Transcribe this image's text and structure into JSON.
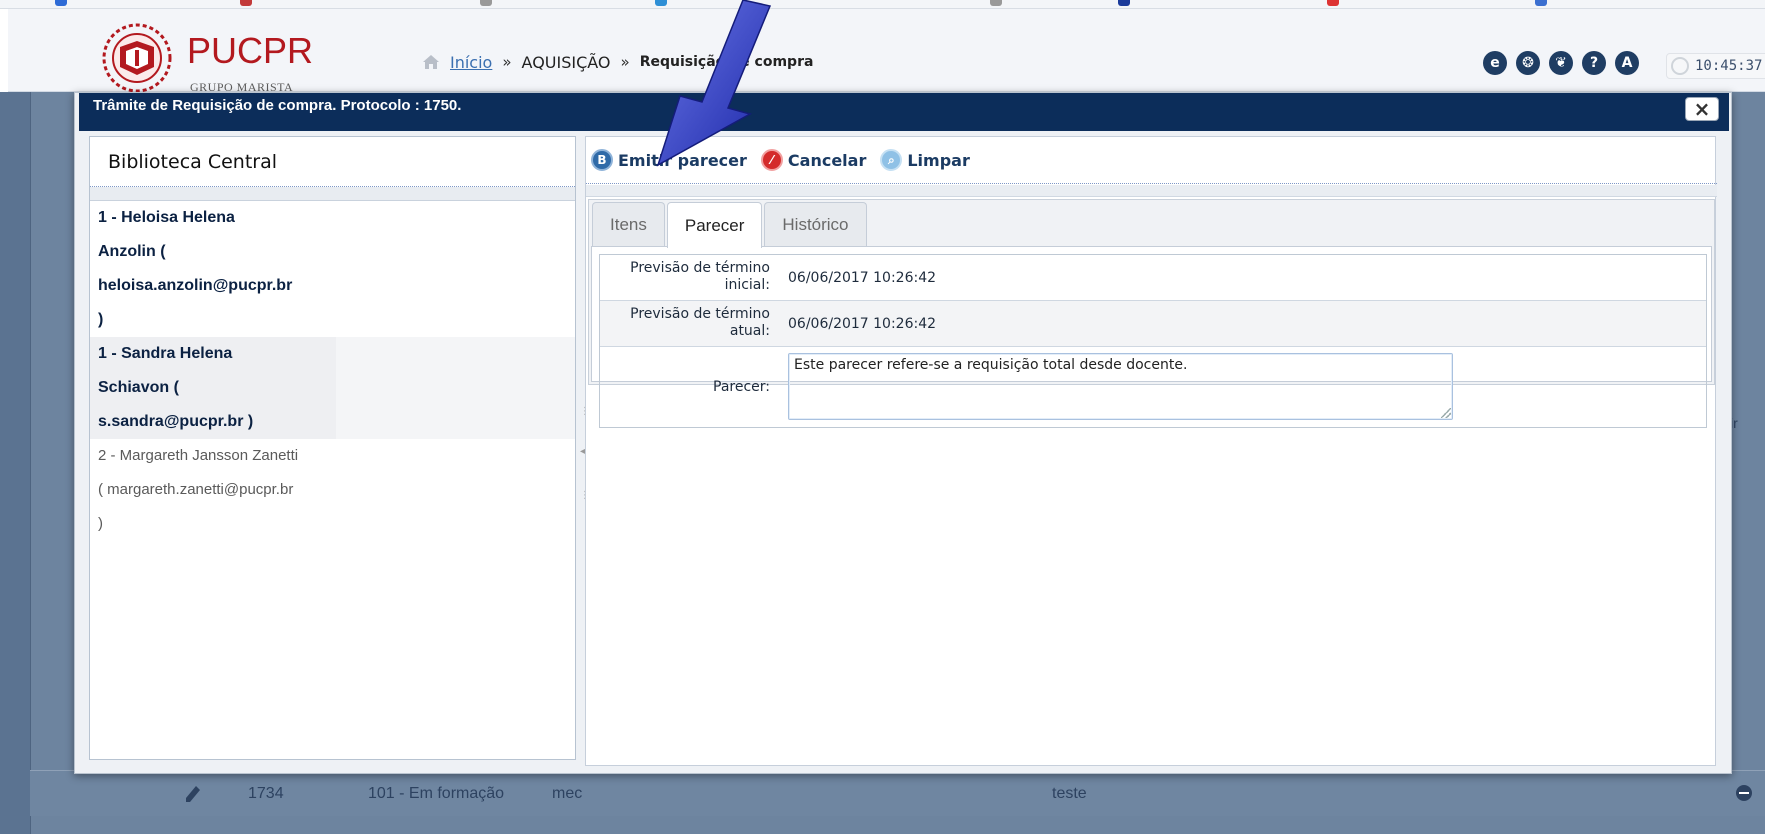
{
  "header": {
    "logo_name": "PUCPR",
    "logo_sub": "GRUPO MARISTA",
    "breadcrumb": {
      "home_label": "Início",
      "separator": "»",
      "section": "AQUISIÇÃO",
      "current": "Requisição de compra"
    },
    "icons": [
      "ie-icon",
      "leaf-icon",
      "paw-icon",
      "help-icon",
      "user-icon"
    ],
    "clock": "10:45:37"
  },
  "modal": {
    "title": "Trâmite de Requisição de compra. Protocolo : 1750.",
    "close_label": "×"
  },
  "left_pane": {
    "title": "Biblioteca Central",
    "people": [
      {
        "lines": [
          "1 - Heloisa Helena",
          "Anzolin (",
          "heloisa.anzolin@pucpr.br",
          ")"
        ]
      },
      {
        "lines": [
          "1 - Sandra Helena",
          "Schiavon (",
          "s.sandra@pucpr.br )"
        ]
      },
      {
        "lines": [
          "2 - Margareth Jansson Zanetti",
          "( margareth.zanetti@pucpr.br",
          ")"
        ]
      }
    ]
  },
  "toolbar": {
    "emit_label": "Emitir parecer",
    "cancel_label": "Cancelar",
    "clear_label": "Limpar"
  },
  "tabs": [
    "Itens",
    "Parecer",
    "Histórico"
  ],
  "active_tab": "Parecer",
  "form": {
    "initial_label": "Previsão de término inicial:",
    "initial_value": "06/06/2017 10:26:42",
    "current_label": "Previsão de término atual:",
    "current_value": "06/06/2017 10:26:42",
    "opinion_label": "Parecer:",
    "opinion_value": "Este parecer refere-se a requisição total desde docente."
  },
  "background_row": {
    "id": "1734",
    "status": "101 - Em formação",
    "col3": "mec",
    "col4": "teste"
  },
  "colors": {
    "title_bar": "#0c2d5a",
    "brand_red": "#b3191f",
    "link": "#3a6fb0",
    "arrow": "#2a37c9"
  }
}
